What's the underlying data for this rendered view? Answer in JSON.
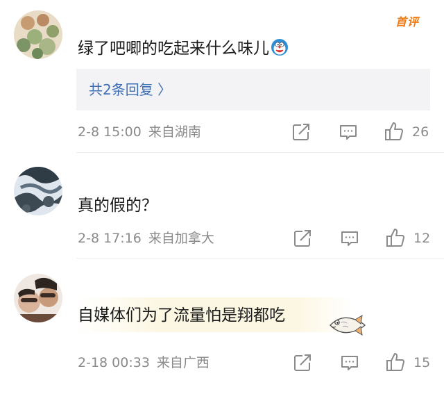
{
  "comments": [
    {
      "text": "绿了吧唧的吃起来什么味儿",
      "badge": "首评",
      "replies_label": "共2条回复 〉",
      "time": "2-8 15:00",
      "location": "来自湖南",
      "likes": "26",
      "emoji": "doraemon-emoji"
    },
    {
      "text": "真的假的？",
      "time": "2-8 17:16",
      "location": "来自加拿大",
      "likes": "12"
    },
    {
      "text": "自媒体们为了流量怕是翔都吃",
      "time": "2-18 00:33",
      "location": "来自广西",
      "likes": "15",
      "emoji": "fish-emoji"
    }
  ],
  "colors": {
    "link": "#3d6fb5",
    "badge": "#f07a12",
    "meta": "#8a8a8a",
    "reply_box": "#f3f3f5"
  },
  "icons": [
    "share-icon",
    "comment-icon",
    "like-icon"
  ]
}
